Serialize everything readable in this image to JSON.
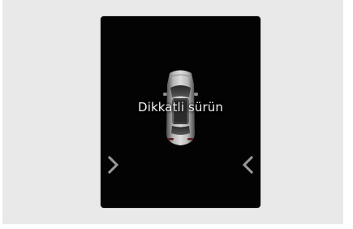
{
  "display": {
    "message": "Dikkatli sürün"
  },
  "icons": {
    "vehicle": "car-top-view-icon",
    "left_indicator": "chevron-right-icon",
    "right_indicator": "chevron-left-icon"
  },
  "colors": {
    "screen_background": "#030303",
    "text": "#f2f2f2",
    "arrow": "#9a9a9a",
    "frame": "#e9e9e9"
  }
}
